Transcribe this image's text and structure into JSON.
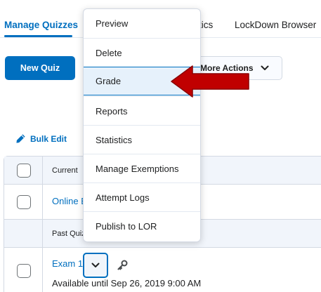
{
  "tabs": {
    "manage": "Manage Quizzes",
    "statistics_partial": "tics",
    "lockdown": "LockDown Browser"
  },
  "toolbar": {
    "new_quiz": "New Quiz",
    "more_actions": "More Actions"
  },
  "bulk_edit": "Bulk Edit",
  "table": {
    "header_partial": "Current",
    "online_partial": "Online E",
    "past_partial": "Past Quiz",
    "exam_partial": "Exam 1",
    "availability": "Available until Sep 26, 2019 9:00 AM"
  },
  "menu": {
    "items": [
      "Preview",
      "Delete",
      "Grade",
      "Reports",
      "Statistics",
      "Manage Exemptions",
      "Attempt Logs",
      "Publish to LOR"
    ],
    "highlighted": "Grade"
  },
  "colors": {
    "accent": "#006fbf",
    "highlight_bg": "#e6f1fb",
    "arrow": "#c00000"
  }
}
